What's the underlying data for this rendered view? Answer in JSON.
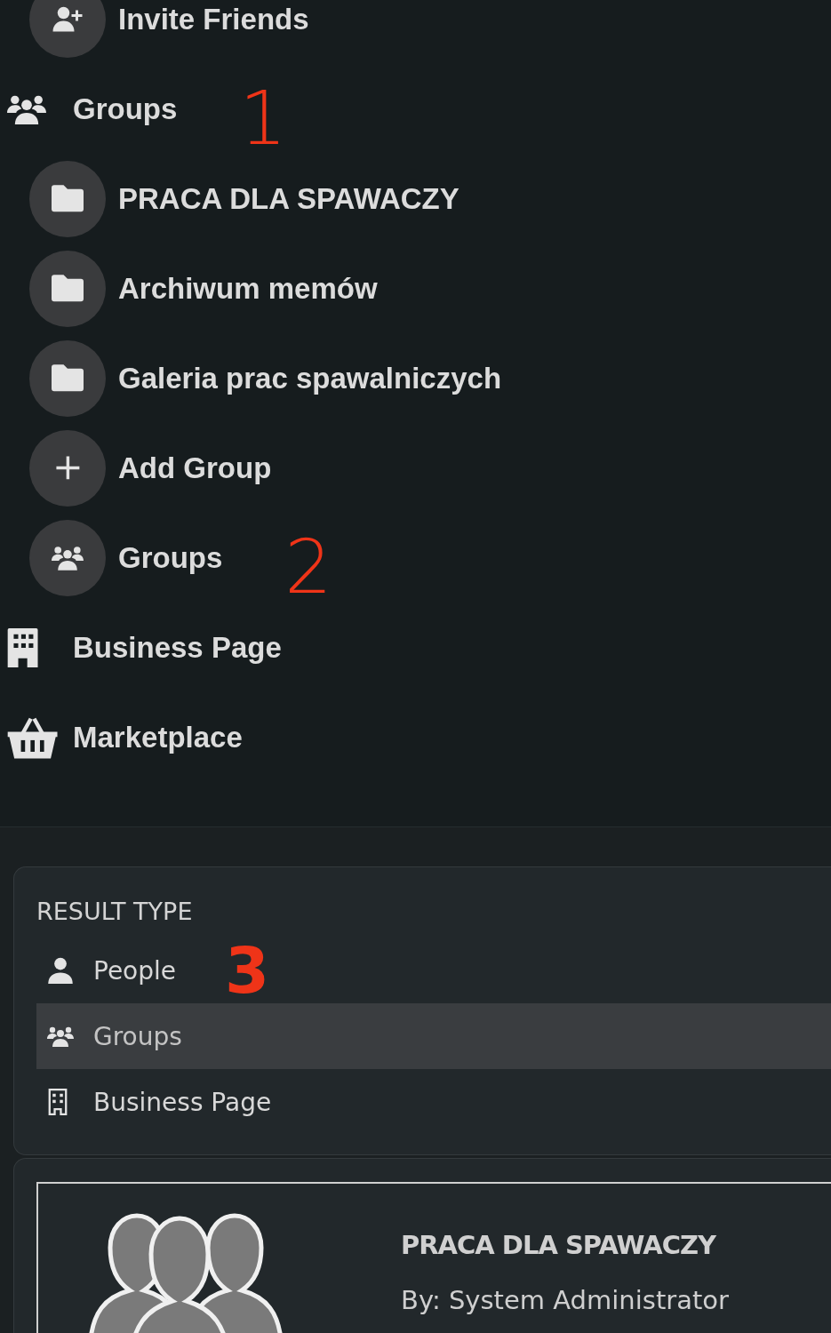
{
  "sidebar": {
    "items": [
      {
        "kind": "sub",
        "label": "Invite Friends"
      },
      {
        "kind": "top",
        "label": "Groups",
        "annotation": "1"
      },
      {
        "kind": "sub",
        "label": "PRACA DLA SPAWACZY"
      },
      {
        "kind": "sub",
        "label": "Archiwum memów"
      },
      {
        "kind": "sub",
        "label": "Galeria prac spawalniczych"
      },
      {
        "kind": "sub",
        "label": "Add Group"
      },
      {
        "kind": "sub",
        "label": "Groups",
        "annotation": "2"
      },
      {
        "kind": "top",
        "label": "Business Page"
      },
      {
        "kind": "top",
        "label": "Marketplace"
      }
    ]
  },
  "filter": {
    "title": "RESULT TYPE",
    "options": [
      {
        "label": "People",
        "selected": false,
        "annotation": "3"
      },
      {
        "label": "Groups",
        "selected": true
      },
      {
        "label": "Business Page",
        "selected": false
      }
    ]
  },
  "result": {
    "kind": "picture",
    "title": "PRACA DLA SPAWACZY",
    "byline": "By: System Administrator"
  }
}
